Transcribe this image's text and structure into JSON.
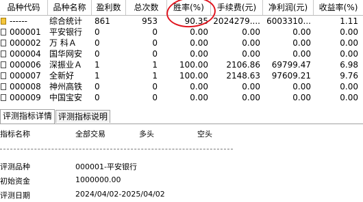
{
  "table": {
    "headers": [
      "品种代码",
      "品种名称",
      "盈利数",
      "总次数",
      "胜率(%)",
      "手续费(元)",
      "净利润(元)",
      "收益率(%)"
    ],
    "rows": [
      [
        "------",
        "综合统计",
        "861",
        "953",
        "90.35",
        "2024279....",
        "6003310...",
        "1.11"
      ],
      [
        "000001",
        "平安银行",
        "0",
        "0",
        "0.00",
        "0.00",
        "0.00",
        "0.00"
      ],
      [
        "000002",
        "万 科Ａ",
        "0",
        "0",
        "0.00",
        "0.00",
        "0.00",
        "0.00"
      ],
      [
        "000004",
        "国华网安",
        "0",
        "0",
        "0.00",
        "0.00",
        "0.00",
        "0.00"
      ],
      [
        "000006",
        "深振业Ａ",
        "1",
        "1",
        "100.00",
        "2106.86",
        "69799.47",
        "6.98"
      ],
      [
        "000007",
        "全新好",
        "1",
        "1",
        "100.00",
        "2148.63",
        "97609.21",
        "9.76"
      ],
      [
        "000008",
        "神州高铁",
        "0",
        "0",
        "0.00",
        "0.00",
        "0.00",
        "0.00"
      ],
      [
        "000009",
        "中国宝安",
        "0",
        "0",
        "0.00",
        "0.00",
        "0.00",
        "0.00"
      ]
    ]
  },
  "tabs": [
    "评测指标详情",
    "评测指标说明"
  ],
  "detail": {
    "col_headers": [
      "指标名称",
      "全部交易",
      "多头",
      "空头"
    ],
    "items": [
      {
        "label": "评测品种",
        "value": "000001-平安银行"
      },
      {
        "label": "初始资金",
        "value": "1000000.00"
      },
      {
        "label": "评测日期",
        "value": "2024/04/02-2025/04/02"
      }
    ]
  },
  "colors": {
    "highlight": "#e0141e",
    "summary_icon": "#f4c63d"
  }
}
